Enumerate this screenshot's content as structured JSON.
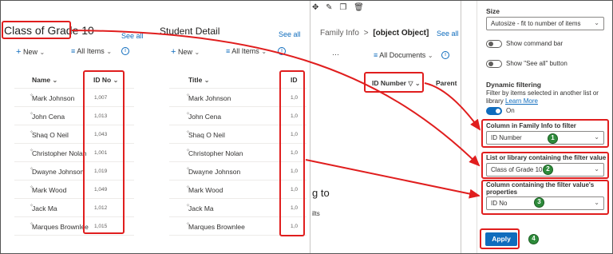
{
  "panel1": {
    "title": "Class of Grade 10",
    "see_all": "See all",
    "new_label": "New",
    "all_items": "All Items",
    "col_name": "Name",
    "col_id": "ID No",
    "rows": [
      {
        "name": "Mark Johnson",
        "id": "1,007"
      },
      {
        "name": "John Cena",
        "id": "1,013"
      },
      {
        "name": "Shaq O Neil",
        "id": "1,043"
      },
      {
        "name": "Christopher Nolan",
        "id": "1,001"
      },
      {
        "name": "Dwayne Johnson",
        "id": "1,019"
      },
      {
        "name": "Mark Wood",
        "id": "1,049"
      },
      {
        "name": "Jack Ma",
        "id": "1,012"
      },
      {
        "name": "Marques Brownlee",
        "id": "1,015"
      }
    ]
  },
  "panel2": {
    "title": "Student Detail",
    "see_all": "See all",
    "new_label": "New",
    "all_items": "All Items",
    "col_title": "Title",
    "col_id": "ID",
    "rows": [
      {
        "name": "Mark Johnson",
        "id": "1,0"
      },
      {
        "name": "John Cena",
        "id": "1,0"
      },
      {
        "name": "Shaq O Neil",
        "id": "1,0"
      },
      {
        "name": "Christopher Nolan",
        "id": "1,0"
      },
      {
        "name": "Dwayne Johnson",
        "id": "1,0"
      },
      {
        "name": "Mark Wood",
        "id": "1,0"
      },
      {
        "name": "Jack Ma",
        "id": "1,0"
      },
      {
        "name": "Marques Brownlee",
        "id": "1,0"
      }
    ]
  },
  "panel3": {
    "title": "Family Info",
    "separator": ">",
    "subtitle": "[object Object]",
    "see_all": "See all",
    "ellipsis": "···",
    "all_documents": "All Documents",
    "col_id_number": "ID Number",
    "col_parent": "Parent",
    "fragment_1": "g to",
    "fragment_2": "ilts"
  },
  "settings": {
    "size_label": "Size",
    "size_value": "Autosize - fit to number of items",
    "show_command_bar": "Show command bar",
    "show_see_all": "Show \"See all\" button",
    "dynamic_filtering": "Dynamic filtering",
    "filter_desc_1": "Filter by items selected in another list or",
    "filter_desc_2": "library",
    "learn_more": "Learn More",
    "on_label": "On",
    "col_family_label": "Column in Family Info to filter",
    "col_family_value": "ID Number",
    "list_label": "List or library containing the filter value",
    "list_value": "Class of Grade 10",
    "col_props_label_1": "Column containing the filter value's",
    "col_props_label_2": "properties",
    "col_props_value": "ID No",
    "apply_label": "Apply",
    "badges": [
      "1",
      "2",
      "3",
      "4"
    ]
  },
  "colors": {
    "accent": "#0f6cbd",
    "highlight": "#e01e1e",
    "badge": "#2e8b3b"
  }
}
